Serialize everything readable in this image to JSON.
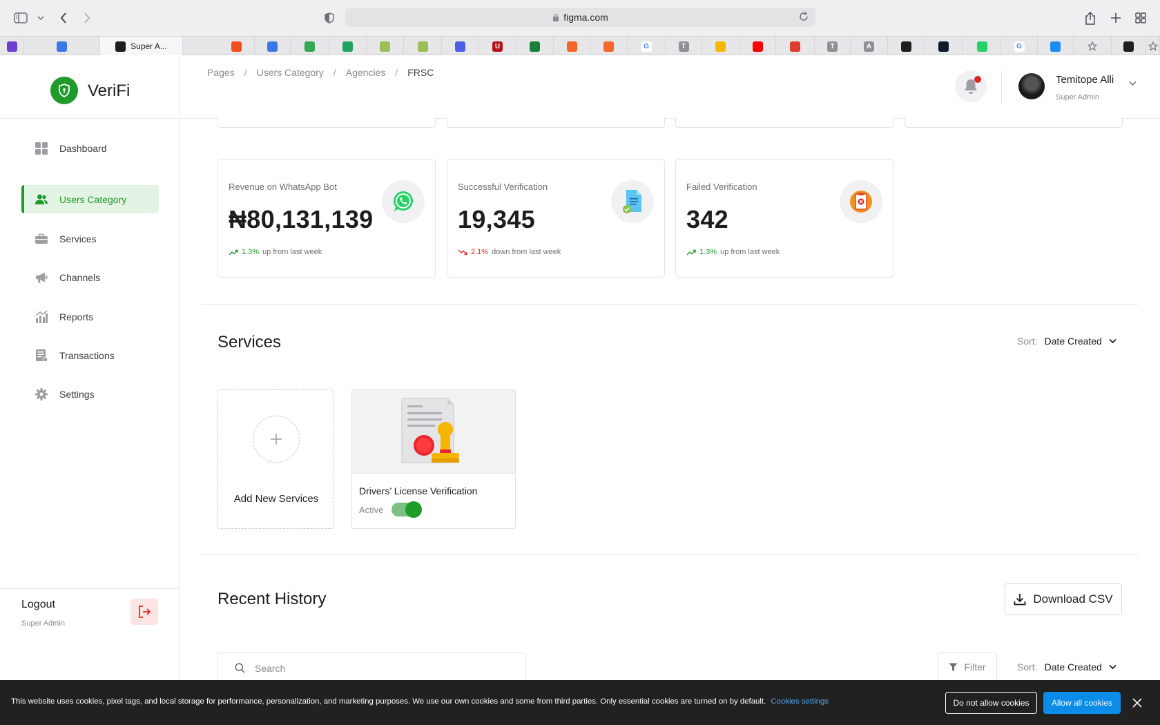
{
  "browser": {
    "url": "figma.com",
    "active_tab_label": "Super A...",
    "bookmarks": [
      {
        "icon": "play-icon",
        "color": "#6e3fd1",
        "letter": ""
      },
      {
        "icon": "google-docs-icon",
        "color": "#3b78e7",
        "letter": ""
      },
      {
        "icon": "figma-icon",
        "color": "#1e1e1e",
        "letter": ""
      },
      {
        "icon": "figma-icon",
        "color": "#f24e1e",
        "letter": ""
      },
      {
        "icon": "google-docs-icon",
        "color": "#3b78e7",
        "letter": ""
      },
      {
        "icon": "sheet-icon",
        "color": "#34a853",
        "letter": ""
      },
      {
        "icon": "green-app-icon",
        "color": "#1ea362",
        "letter": ""
      },
      {
        "icon": "logo-icon",
        "color": "#9bbf56",
        "letter": ""
      },
      {
        "icon": "logo-icon",
        "color": "#9bbf56",
        "letter": ""
      },
      {
        "icon": "globe-icon",
        "color": "#4a5ee8",
        "letter": ""
      },
      {
        "icon": "u-icon",
        "color": "#b4121b",
        "letter": "U"
      },
      {
        "icon": "sheets-icon",
        "color": "#188038",
        "letter": ""
      },
      {
        "icon": "orange-icon",
        "color": "#f5662a",
        "letter": ""
      },
      {
        "icon": "orange-icon",
        "color": "#f5662a",
        "letter": ""
      },
      {
        "icon": "google-icon",
        "color": "#ffffff",
        "letter": "G"
      },
      {
        "icon": "t-icon",
        "color": "#8f8f94",
        "letter": "T"
      },
      {
        "icon": "keep-icon",
        "color": "#f7b900",
        "letter": ""
      },
      {
        "icon": "youtube-icon",
        "color": "#ff0000",
        "letter": ""
      },
      {
        "icon": "speed-icon",
        "color": "#e03c31",
        "letter": ""
      },
      {
        "icon": "t-icon",
        "color": "#8f8f94",
        "letter": "T"
      },
      {
        "icon": "a-icon",
        "color": "#8f8f94",
        "letter": "A"
      },
      {
        "icon": "figma-icon",
        "color": "#1e1e1e",
        "letter": ""
      },
      {
        "icon": "dark-app-icon",
        "color": "#0d1b2a",
        "letter": ""
      },
      {
        "icon": "whatsapp-icon",
        "color": "#25d366",
        "letter": ""
      },
      {
        "icon": "google-icon",
        "color": "#ffffff",
        "letter": "G"
      },
      {
        "icon": "appstore-icon",
        "color": "#1b8cf5",
        "letter": ""
      },
      {
        "icon": "star-icon",
        "color": "#e7e7ea",
        "letter": ""
      },
      {
        "icon": "figma-icon",
        "color": "#1e1e1e",
        "letter": ""
      },
      {
        "icon": "star-icon",
        "color": "#e7e7ea",
        "letter": ""
      }
    ]
  },
  "app": {
    "name": "VeriFi",
    "brand_color": "#1e9b29"
  },
  "sidebar": {
    "items": [
      {
        "label": "Dashboard",
        "icon": "dashboard-grid-icon",
        "active": false
      },
      {
        "label": "Users Category",
        "icon": "users-icon",
        "active": true
      },
      {
        "label": "Services",
        "icon": "briefcase-icon",
        "active": false
      },
      {
        "label": "Channels",
        "icon": "megaphone-icon",
        "active": false
      },
      {
        "label": "Reports",
        "icon": "bar-chart-icon",
        "active": false
      },
      {
        "label": "Transactions",
        "icon": "receipt-icon",
        "active": false
      },
      {
        "label": "Settings",
        "icon": "gear-icon",
        "active": false
      }
    ],
    "logout": {
      "label": "Logout",
      "role": "Super Admin"
    }
  },
  "header": {
    "breadcrumb": [
      "Pages",
      "Users Category",
      "Agencies",
      "FRSC"
    ],
    "user": {
      "name": "Temitope Alli",
      "role": "Super Admin"
    }
  },
  "stats": [
    {
      "title": "Revenue on WhatsApp Bot",
      "value": "₦80,131,139",
      "change": "1.3%",
      "direction": "up",
      "change_text": "up from last week",
      "icon": "whatsapp-icon"
    },
    {
      "title": "Successful Verification",
      "value": "19,345",
      "change": "2.1%",
      "direction": "down",
      "change_text": "down from last week",
      "icon": "document-check-icon"
    },
    {
      "title": "Failed Verification",
      "value": "342",
      "change": "1.3%",
      "direction": "up",
      "change_text": "up from last week",
      "icon": "clipboard-error-icon"
    }
  ],
  "services": {
    "title": "Services",
    "sort_label": "Sort:",
    "sort_value": "Date Created",
    "add_label": "Add New Services",
    "items": [
      {
        "name": "Drivers’ License Verification",
        "status": "Active",
        "enabled": true
      }
    ]
  },
  "history": {
    "title": "Recent History",
    "download_label": "Download CSV",
    "search_placeholder": "Search",
    "filter_label": "Filter",
    "sort_label": "Sort:",
    "sort_value": "Date Created"
  },
  "cookies": {
    "text": "This website uses cookies, pixel tags, and local storage for performance, personalization, and marketing purposes. We use our own cookies and some from third parties. Only essential cookies are turned on by default.",
    "settings_link": "Cookies settings",
    "deny_label": "Do not allow cookies",
    "allow_label": "Allow all cookies"
  }
}
